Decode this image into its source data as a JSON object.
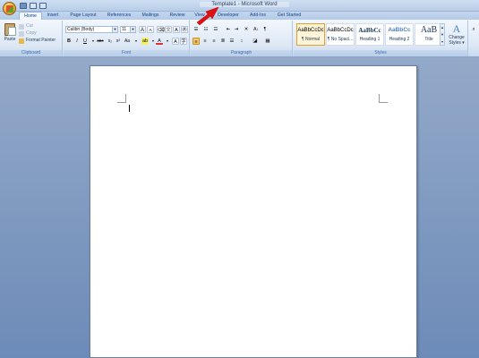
{
  "window": {
    "title": "Template1 - Microsoft Word"
  },
  "tabs": [
    "Home",
    "Insert",
    "Page Layout",
    "References",
    "Mailings",
    "Review",
    "View",
    "Developer",
    "Add-Ins",
    "Get Started"
  ],
  "clipboard": {
    "paste_label": "Paste",
    "cut_label": "Cut",
    "copy_label": "Copy",
    "format_painter_label": "Format Painter",
    "group_label": "Clipboard"
  },
  "font": {
    "font_name": "Calibri (Body)",
    "font_size": "11",
    "grow_label": "A",
    "shrink_label": "A",
    "bold_label": "B",
    "italic_label": "I",
    "underline_label": "U",
    "strike_label": "abc",
    "sub_label": "x₂",
    "sup_label": "x²",
    "case_label": "Aa",
    "color_label": "A",
    "group_label": "Font"
  },
  "paragraph": {
    "group_label": "Paragraph",
    "sort_label": "A↓",
    "pilcrow_label": "¶"
  },
  "styles": {
    "items": [
      {
        "sample": "AaBbCcDc",
        "name": "¶ Normal",
        "selected": true
      },
      {
        "sample": "AaBbCcDc",
        "name": "¶ No Spaci...",
        "selected": false
      },
      {
        "sample": "AaBbCc",
        "name": "Heading 1",
        "selected": false
      },
      {
        "sample": "AaBbCc",
        "name": "Heading 2",
        "selected": false
      },
      {
        "sample": "AaB",
        "name": "Title",
        "selected": false
      }
    ],
    "change_styles_line1": "Change",
    "change_styles_line2": "Styles ▾",
    "change_styles_glyph": "A",
    "group_label": "Styles"
  },
  "colors": {
    "accent": "#e03030",
    "highlight": "#f7c76a"
  }
}
